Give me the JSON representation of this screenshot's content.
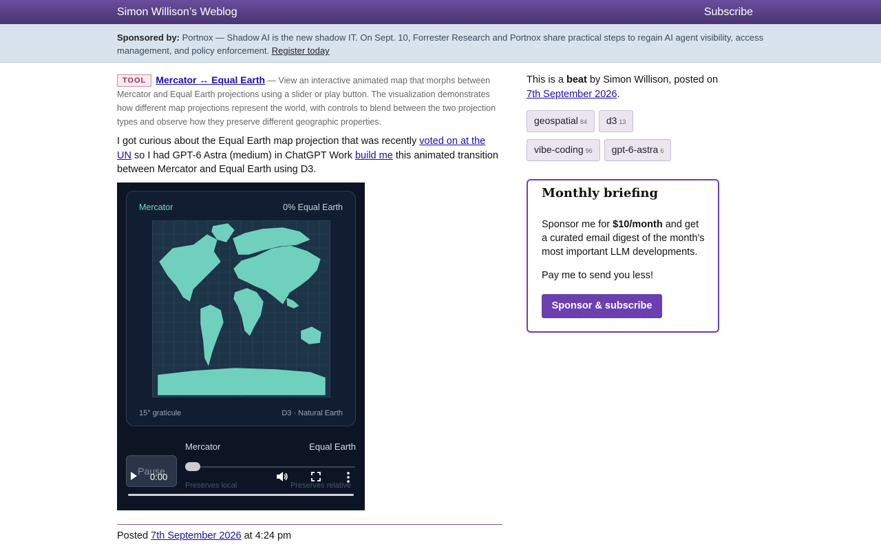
{
  "header": {
    "brand": "Simon Willison’s Weblog",
    "subscribe": "Subscribe"
  },
  "sponsor": {
    "label": "Sponsored by:",
    "text": "Portnox — Shadow AI is the new shadow IT. On Sept. 10, Forrester Research and Portnox share practical steps to regain AI agent visibility, access management, and policy enforcement.",
    "link": "Register today"
  },
  "tool": {
    "badge": "TOOL",
    "title": "Mercator ↔ Equal Earth",
    "description": "— View an interactive animated map that morphs between Mercator and Equal Earth projections using a slider or play button. The visualization demonstrates how different map projections represent the world, with controls to blend between the two projection types and observe how they preserve different geographic properties."
  },
  "body": {
    "t1": "I got curious about the Equal Earth map projection that was recently ",
    "link1": "voted on at the UN",
    "t2": " so I had GPT-6 Astra (medium) in ChatGPT Work ",
    "link2": "build me",
    "t3": " this animated transition between Mercator and Equal Earth using D3."
  },
  "video": {
    "label_left": "Mercator",
    "label_right": "0% Equal Earth",
    "foot_left": "15° graticule",
    "foot_right": "D3 · Natural Earth",
    "slider_left": "Mercator",
    "slider_right": "Equal Earth",
    "pause": "Pause",
    "ghost_left": "Preserves local",
    "ghost_right": "Preserves relative",
    "time": "0:00",
    "progress": 0,
    "land_color": "#6fd1bd"
  },
  "posted": {
    "prefix": "Posted ",
    "date": "7th September 2026",
    "suffix": " at 4:24 pm"
  },
  "sidebar": {
    "beat_prefix": "This is a ",
    "beat_word": "beat",
    "beat_mid": " by Simon Willison, posted on ",
    "beat_date": "7th September 2026",
    "beat_end": ".",
    "tags": [
      {
        "name": "geospatial",
        "count": "84"
      },
      {
        "name": "d3",
        "count": "13"
      },
      {
        "name": "vibe-coding",
        "count": "96"
      },
      {
        "name": "gpt-6-astra",
        "count": "6"
      }
    ],
    "briefing": {
      "title": "Monthly briefing",
      "p1a": "Sponsor me for ",
      "p1b": "$10/month",
      "p1c": " and get a curated email digest of the month's most important LLM developments.",
      "p2": "Pay me to send you less!",
      "button": "Sponsor & subscribe"
    }
  }
}
